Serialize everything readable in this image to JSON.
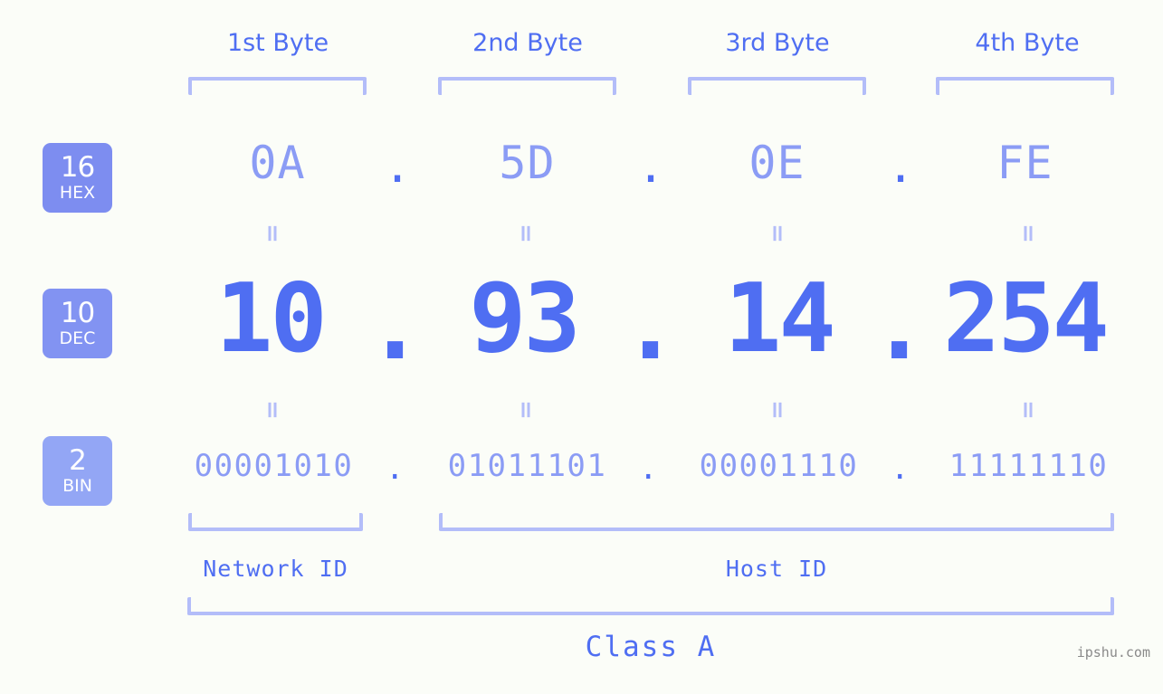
{
  "meta": {
    "background_color": "#fbfdf8",
    "accent_color": "#4f6ef2",
    "muted_accent_color": "#8b9cf5",
    "light_accent_color": "#b3bdf9",
    "badge_strong_color": "#7d8df0",
    "badge_light_color": "#93a6f5",
    "watermark": "ipshu.com"
  },
  "byte_headers": [
    {
      "label": "1st Byte"
    },
    {
      "label": "2nd Byte"
    },
    {
      "label": "3rd Byte"
    },
    {
      "label": "4th Byte"
    }
  ],
  "rows": {
    "hex": {
      "badge_number": "16",
      "badge_unit": "HEX",
      "values": [
        "0A",
        "5D",
        "0E",
        "FE"
      ],
      "separator": "."
    },
    "dec": {
      "badge_number": "10",
      "badge_unit": "DEC",
      "values": [
        "10",
        "93",
        "14",
        "254"
      ],
      "separator": "."
    },
    "bin": {
      "badge_number": "2",
      "badge_unit": "BIN",
      "values": [
        "00001010",
        "01011101",
        "00001110",
        "11111110"
      ],
      "separator": "."
    }
  },
  "equal_marks": {
    "glyph": "=",
    "count_per_row": 4
  },
  "footer": {
    "network_id_label": "Network ID",
    "host_id_label": "Host ID",
    "class_label": "Class A"
  },
  "address": {
    "dotted_decimal": "10.93.14.254",
    "hex": "0A.5D.0E.FE",
    "binary": "00001010.01011101.00001110.11111110",
    "class": "Class A",
    "network_bytes": 1,
    "host_bytes": 3
  }
}
